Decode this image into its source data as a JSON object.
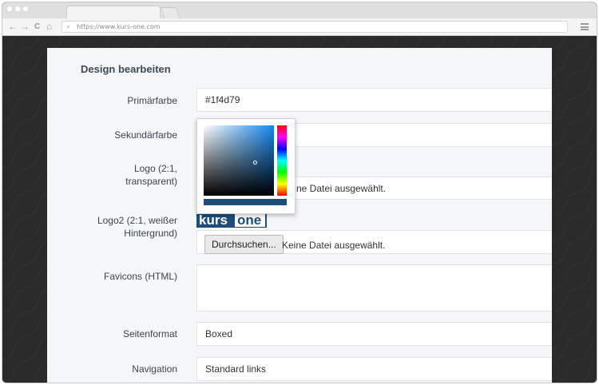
{
  "browser": {
    "url": "https://www.kurs-one.com",
    "nav": {
      "back": "←",
      "forward": "→",
      "reload": "C",
      "home": "⌂"
    }
  },
  "panel": {
    "title": "Design bearbeiten"
  },
  "form": {
    "primary": {
      "label": "Primärfarbe",
      "value": "#1f4d79"
    },
    "secondary": {
      "label": "Sekundärfarbe",
      "value": ""
    },
    "logo": {
      "label": "Logo (2:1, transparent)",
      "file_status": "Keine Datei ausgewählt.",
      "file_status_visible": "ne Datei ausgewählt."
    },
    "logo2": {
      "label": "Logo2 (2:1, weißer Hintergrund)",
      "preview_text_a": "kurs",
      "preview_text_b": "one",
      "browse_label": "Durchsuchen...",
      "file_status": "Keine Datei ausgewählt."
    },
    "favicons": {
      "label": "Favicons (HTML)",
      "value": ""
    },
    "page_format": {
      "label": "Seitenformat",
      "value": "Boxed"
    },
    "navigation": {
      "label": "Navigation",
      "value": "Standard links"
    }
  },
  "colors": {
    "brand": "#1f4d79",
    "panel_bg": "#f5f6f8",
    "label_text": "#3a4550"
  },
  "icons": {
    "search": "search-icon",
    "menu": "hamburger-menu-icon"
  }
}
